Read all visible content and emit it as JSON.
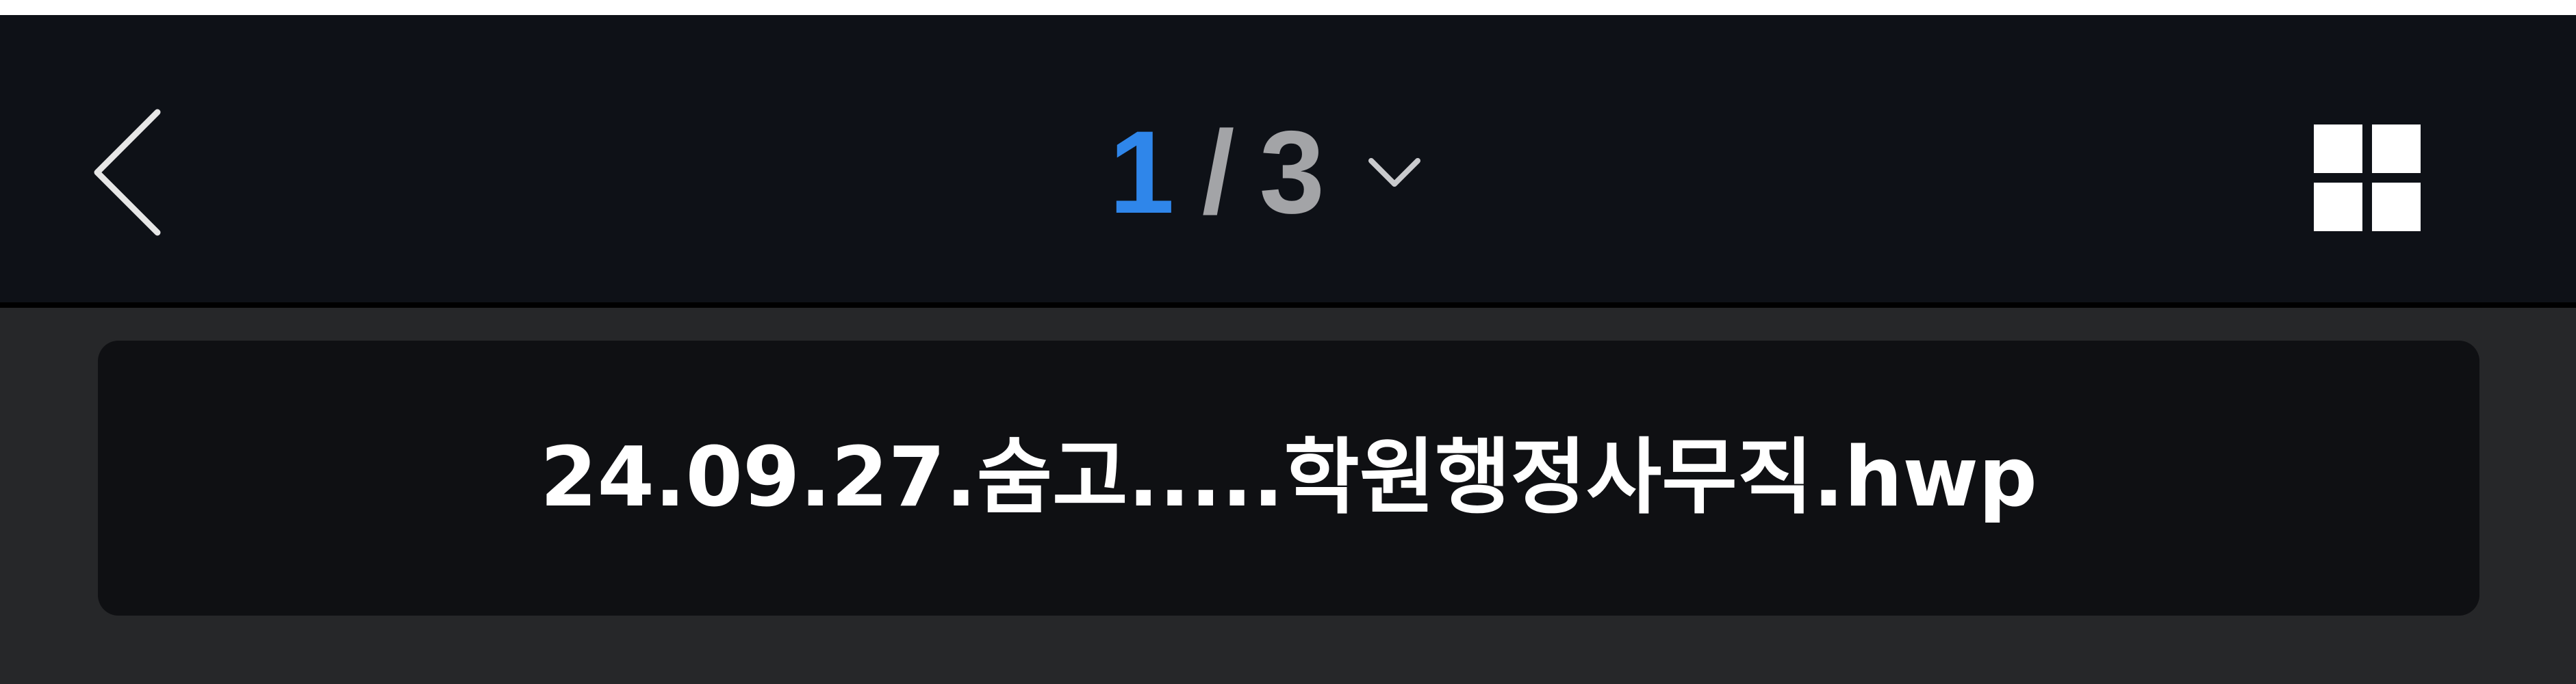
{
  "header": {
    "back_icon": "chevron-left-icon",
    "page_indicator": {
      "current": "1",
      "separator": "/",
      "total": "3",
      "dropdown_icon": "chevron-down-icon"
    },
    "grid_icon": "grid-view-icon"
  },
  "file": {
    "name": "24.09.27.숨고.....학원행정사무직.hwp"
  },
  "colors": {
    "header_background": "#0e1117",
    "content_background": "#262729",
    "card_background": "#0f1013",
    "accent": "#2f86ea",
    "muted_text": "#a3a4a7",
    "primary_text": "#ffffff"
  }
}
